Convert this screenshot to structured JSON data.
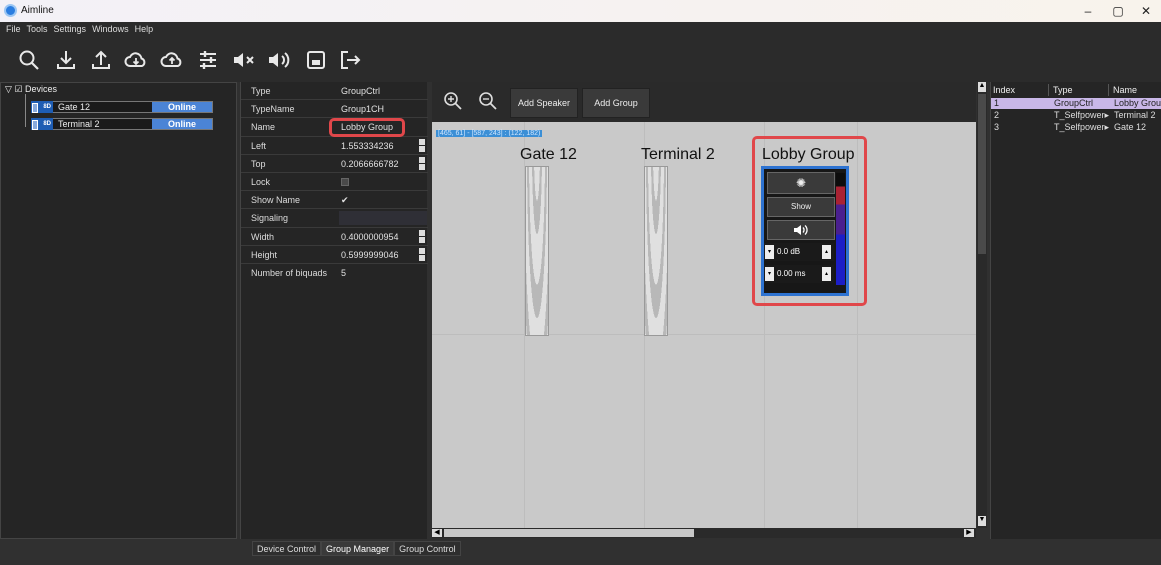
{
  "app": {
    "title": "Aimline"
  },
  "menu": [
    "File",
    "Tools",
    "Settings",
    "Windows",
    "Help"
  ],
  "toolbar_icons": [
    "search-icon",
    "download-icon",
    "upload-icon",
    "cloud-download-icon",
    "cloud-upload-icon",
    "sliders-icon",
    "mute-icon",
    "speaker-icon",
    "save-icon",
    "exit-icon"
  ],
  "devices": {
    "root_label": "Devices",
    "items": [
      {
        "badge": "8D",
        "name": "Gate 12",
        "status": "Online"
      },
      {
        "badge": "8D",
        "name": "Terminal 2",
        "status": "Online"
      }
    ]
  },
  "properties": [
    {
      "key": "Type",
      "value": "GroupCtrl"
    },
    {
      "key": "TypeName",
      "value": "Group1CH"
    },
    {
      "key": "Name",
      "value": "Lobby Group"
    },
    {
      "key": "Left",
      "value": "1.553334236"
    },
    {
      "key": "Top",
      "value": "0.2066666782"
    },
    {
      "key": "Lock",
      "value": ""
    },
    {
      "key": "Show Name",
      "value": "✔"
    },
    {
      "key": "Signaling",
      "value": ""
    },
    {
      "key": "Width",
      "value": "0.4000000954"
    },
    {
      "key": "Height",
      "value": "0.5999999046"
    },
    {
      "key": "Number of biquads",
      "value": "5"
    }
  ],
  "tabs": [
    "Device Control",
    "Group Manager",
    "Group Control"
  ],
  "canvas": {
    "add_speaker": "Add Speaker",
    "add_group": "Add Group",
    "coord_text": "[465, 61] - [587, 243] : (122, 182)",
    "speakers": [
      "Gate 12",
      "Terminal 2"
    ],
    "group": {
      "name": "Lobby Group",
      "show_label": "Show",
      "gain": "0.0 dB",
      "delay": "0.00 ms",
      "meter_level": 0.88
    }
  },
  "table": {
    "headers": [
      "Index",
      "Type",
      "Name"
    ],
    "rows": [
      {
        "index": "1",
        "type": "GroupCtrl",
        "name": "Lobby Group"
      },
      {
        "index": "2",
        "type": "T_Selfpower▸",
        "name": "Terminal 2"
      },
      {
        "index": "3",
        "type": "T_Selfpower▸",
        "name": "Gate 12"
      }
    ]
  },
  "colors": {
    "accent": "#4b84d6",
    "highlight": "#e0474a",
    "selected_row": "#c9b7e8"
  }
}
